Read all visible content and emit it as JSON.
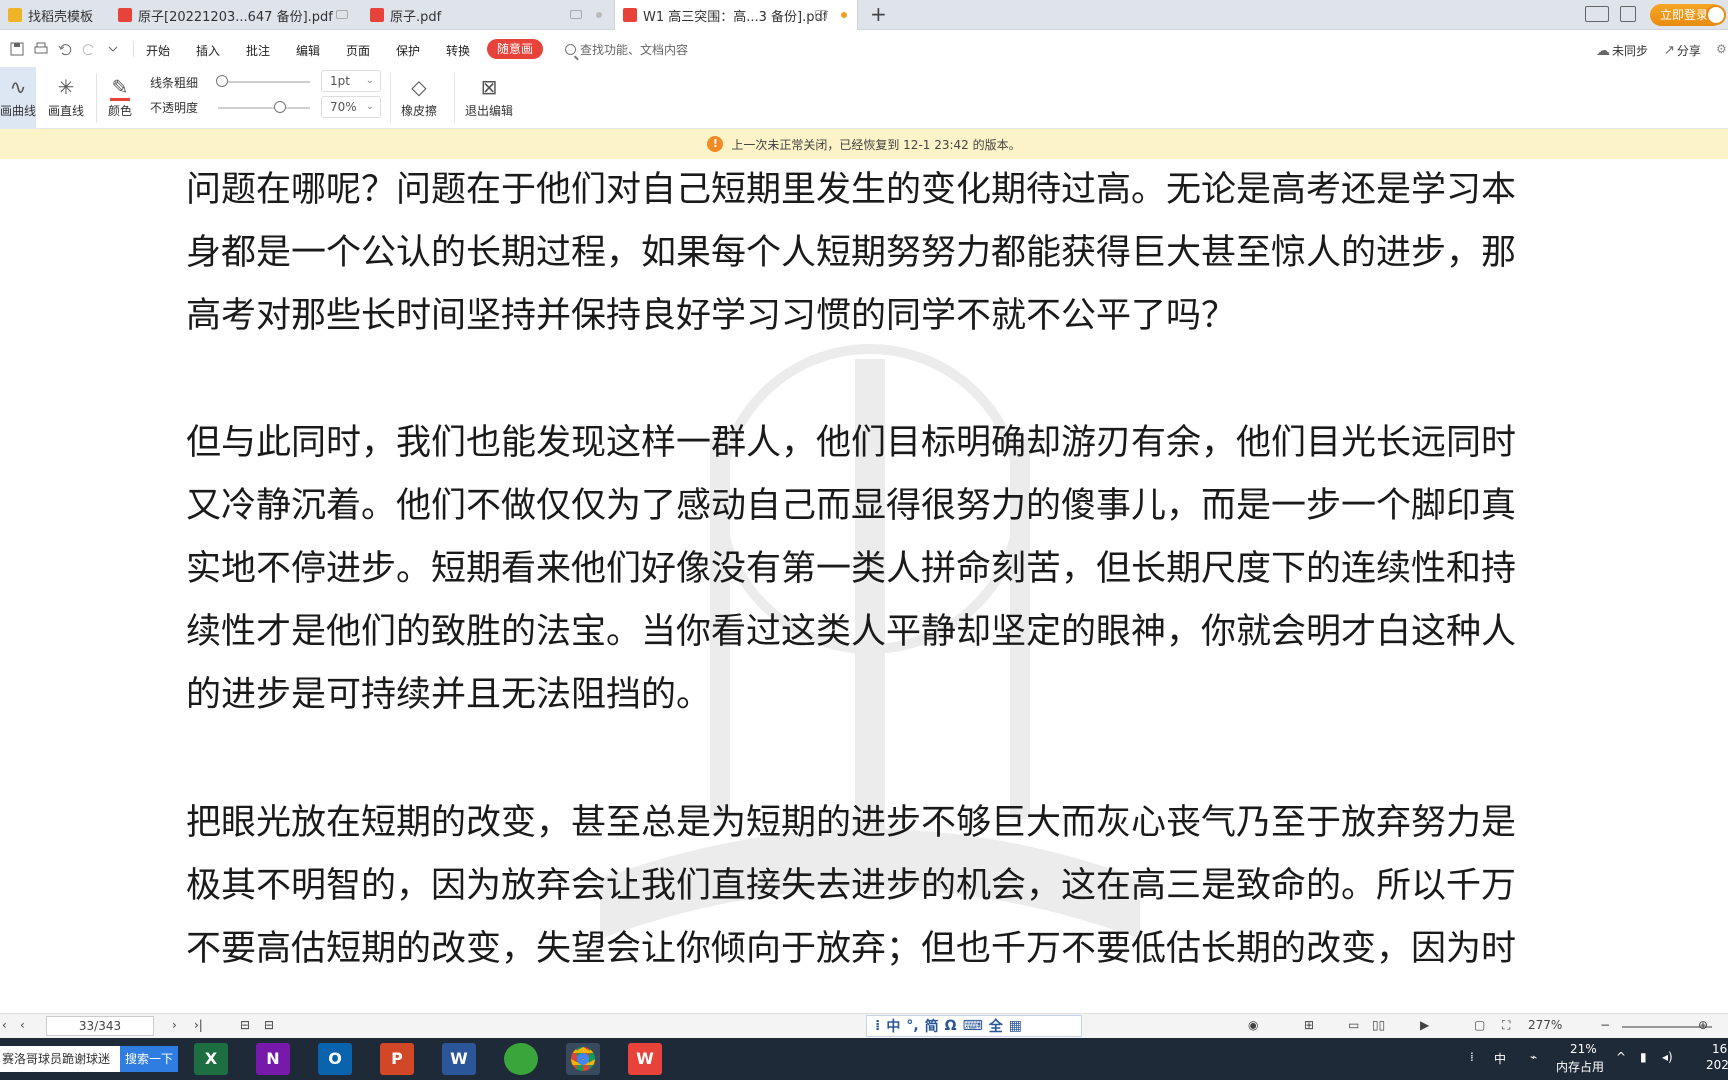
{
  "tabs": [
    {
      "label": "找稻壳模板",
      "color": "#f0b429"
    },
    {
      "label": "原子[20221203...647 备份].pdf",
      "color": "#e8433b"
    },
    {
      "label": "原子.pdf",
      "color": "#e8433b"
    },
    {
      "label": "W1 高三突围：高...3 备份].pdf",
      "color": "#e8433b",
      "active": true
    }
  ],
  "titlebar": {
    "login_label": "立即登录"
  },
  "menu": {
    "items": [
      "开始",
      "插入",
      "批注",
      "编辑",
      "页面",
      "保护",
      "转换"
    ],
    "active_tab": "随意画",
    "search_placeholder": "查找功能、文档内容",
    "sync_label": "未同步",
    "share_label": "分享"
  },
  "toolbar": {
    "draw_curve": "画曲线",
    "draw_line": "画直线",
    "color": "颜色",
    "line_width_label": "线条粗细",
    "line_width_value": "1pt",
    "opacity_label": "不透明度",
    "opacity_value": "70%",
    "eraser": "橡皮擦",
    "exit_edit": "退出编辑"
  },
  "notice": {
    "text": "上一次未正常关闭，已经恢复到 12-1 23:42 的版本。"
  },
  "document": {
    "paragraphs": [
      [
        "问题在哪呢？问题在于他们对自己短期里发生的变化期待过高。无论是高考还是学习本",
        "身都是一个公认的长期过程，如果每个人短期努努力都能获得巨大甚至惊人的进步，那",
        "高考对那些长时间坚持并保持良好学习习惯的同学不就不公平了吗？"
      ],
      [
        "但与此同时，我们也能发现这样一群人，他们目标明确却游刃有余，他们目光长远同时",
        "又冷静沉着。他们不做仅仅为了感动自己而显得很努力的傻事儿，而是一步一个脚印真",
        "实地不停进步。短期看来他们好像没有第一类人拼命刻苦，但长期尺度下的连续性和持",
        "续性才是他们的致胜的法宝。当你看过这类人平静却坚定的眼神，你就会明才白这种人",
        "的进步是可持续并且无法阻挡的。"
      ],
      [
        "把眼光放在短期的改变，甚至总是为短期的进步不够巨大而灰心丧气乃至于放弃努力是",
        "极其不明智的，因为放弃会让我们直接失去进步的机会，这在高三是致命的。所以千万",
        "不要高估短期的改变，失望会让你倾向于放弃；但也千万不要低估长期的改变，因为时"
      ]
    ]
  },
  "statusbar": {
    "page": "33/343",
    "ime": [
      "中",
      "°,",
      "简",
      "Ω",
      "全"
    ],
    "zoom": "277%"
  },
  "taskbar": {
    "search_text": "赛洛哥球员跪谢球迷",
    "search_button": "搜索一下",
    "apps": [
      {
        "name": "excel",
        "letter": "X",
        "color": "#1d6f42"
      },
      {
        "name": "onenote",
        "letter": "N",
        "color": "#7719aa"
      },
      {
        "name": "outlook",
        "letter": "O",
        "color": "#0a64ad"
      },
      {
        "name": "powerpoint",
        "letter": "P",
        "color": "#d24726"
      },
      {
        "name": "word",
        "letter": "W",
        "color": "#2b579a"
      },
      {
        "name": "green-app",
        "letter": "",
        "color": "#3aa53a"
      },
      {
        "name": "chrome",
        "letter": "",
        "color": "#db4437"
      },
      {
        "name": "wps",
        "letter": "W",
        "color": "#e8433b"
      }
    ],
    "tray": {
      "ime": "中",
      "memory_percent": "21%",
      "memory_label": "内存占用",
      "time": "16",
      "date": "202"
    }
  }
}
